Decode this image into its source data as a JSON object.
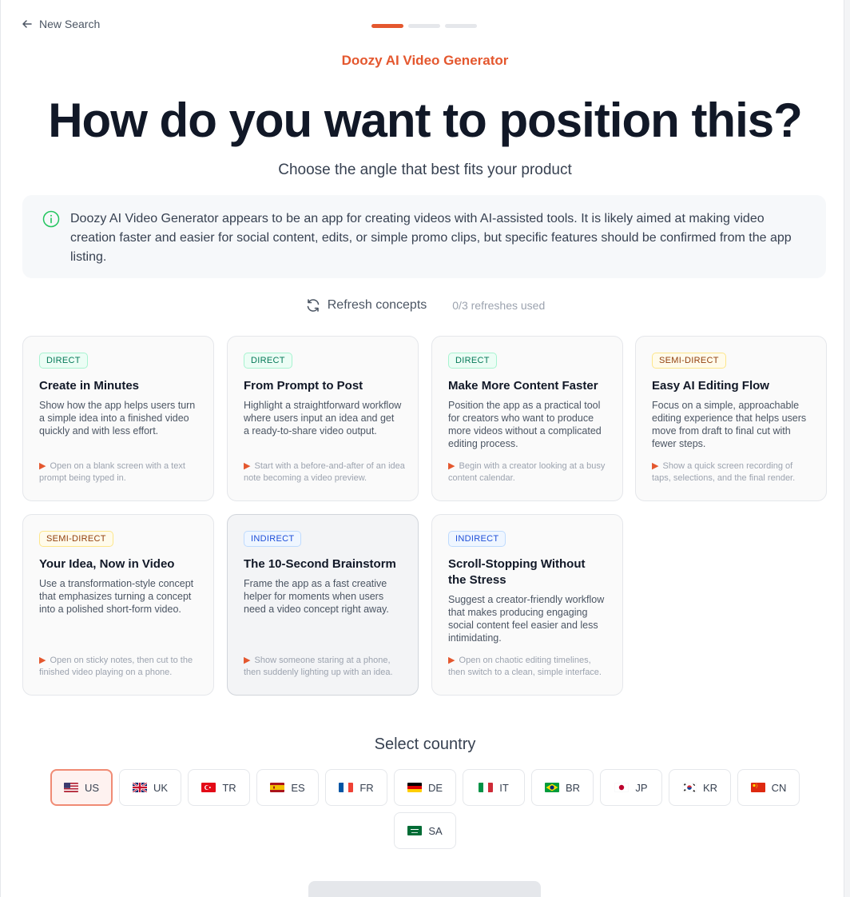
{
  "nav": {
    "back_label": "New Search",
    "steps_total": 3,
    "current_step": 1
  },
  "header": {
    "eyebrow": "Doozy AI Video Generator",
    "title": "How do you want to position this?",
    "subtitle": "Choose the angle that best fits your product"
  },
  "info": {
    "text": "Doozy AI Video Generator appears to be an app for creating videos with AI-assisted tools. It is likely aimed at making video creation faster and easier for social content, edits, or simple promo clips, but specific features should be confirmed from the app listing."
  },
  "refresh": {
    "label": "Refresh concepts",
    "count": "0/3 refreshes used"
  },
  "concepts": [
    {
      "badge": "DIRECT",
      "title": "Create in Minutes",
      "desc": "Show how the app helps users turn a simple idea into a finished video quickly and with less effort.",
      "hint": "Open on a blank screen with a text prompt being typed in."
    },
    {
      "badge": "DIRECT",
      "title": "From Prompt to Post",
      "desc": "Highlight a straightforward workflow where users input an idea and get a ready-to-share video output.",
      "hint": "Start with a before-and-after of an idea note becoming a video preview."
    },
    {
      "badge": "DIRECT",
      "title": "Make More Content Faster",
      "desc": "Position the app as a practical tool for creators who want to produce more videos without a complicated editing process.",
      "hint": "Begin with a creator looking at a busy content calendar."
    },
    {
      "badge": "SEMI-DIRECT",
      "title": "Easy AI Editing Flow",
      "desc": "Focus on a simple, approachable editing experience that helps users move from draft to final cut with fewer steps.",
      "hint": "Show a quick screen recording of taps, selections, and the final render."
    },
    {
      "badge": "SEMI-DIRECT",
      "title": "Your Idea, Now in Video",
      "desc": "Use a transformation-style concept that emphasizes turning a concept into a polished short-form video.",
      "hint": "Open on sticky notes, then cut to the finished video playing on a phone."
    },
    {
      "badge": "INDIRECT",
      "title": "The 10-Second Brainstorm",
      "desc": "Frame the app as a fast creative helper for moments when users need a video concept right away.",
      "hint": "Show someone staring at a phone, then suddenly lighting up with an idea."
    },
    {
      "badge": "INDIRECT",
      "title": "Scroll-Stopping Without the Stress",
      "desc": "Suggest a creator-friendly workflow that makes producing engaging social content feel easier and less intimidating.",
      "hint": "Open on chaotic editing timelines, then switch to a clean, simple interface."
    }
  ],
  "country_section": {
    "title": "Select country",
    "selected": "US",
    "countries": [
      {
        "code": "US",
        "flag": "flag-us-icon"
      },
      {
        "code": "UK",
        "flag": "flag-uk-icon"
      },
      {
        "code": "TR",
        "flag": "flag-tr-icon"
      },
      {
        "code": "ES",
        "flag": "flag-es-icon"
      },
      {
        "code": "FR",
        "flag": "flag-fr-icon"
      },
      {
        "code": "DE",
        "flag": "flag-de-icon"
      },
      {
        "code": "IT",
        "flag": "flag-it-icon"
      },
      {
        "code": "BR",
        "flag": "flag-br-icon"
      },
      {
        "code": "JP",
        "flag": "flag-jp-icon"
      },
      {
        "code": "KR",
        "flag": "flag-kr-icon"
      },
      {
        "code": "CN",
        "flag": "flag-cn-icon"
      },
      {
        "code": "SA",
        "flag": "flag-sa-icon"
      }
    ]
  },
  "colors": {
    "accent": "#e4572e",
    "selected_border": "#f08b74",
    "selected_bg": "#fef2f0"
  }
}
